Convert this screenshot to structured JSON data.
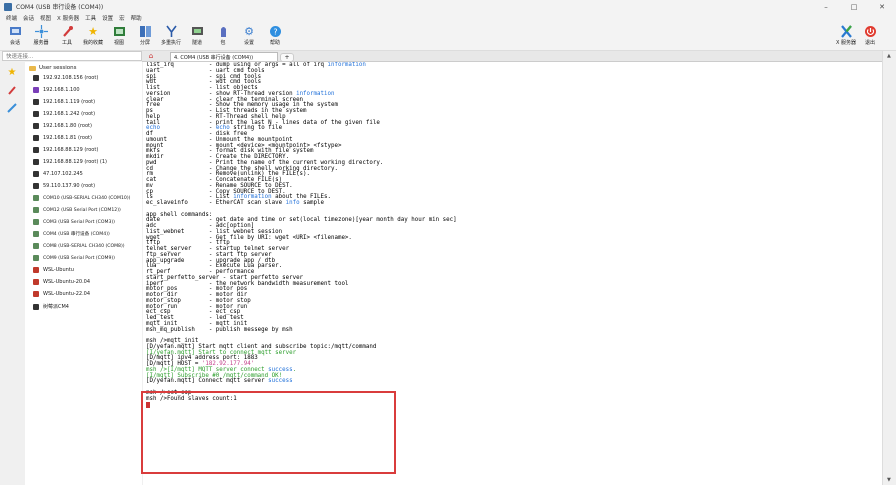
{
  "window": {
    "title": "COM4 (USB 串行设备 (COM4))",
    "controls": [
      "–",
      "□",
      "✕"
    ]
  },
  "menu": [
    "终端",
    "会话",
    "视图",
    "X 服务器",
    "工具",
    "设置",
    "宏",
    "帮助"
  ],
  "toolbar": [
    {
      "label": "会话",
      "icon": "session-icon"
    },
    {
      "label": "服务器",
      "icon": "servers-icon"
    },
    {
      "label": "工具",
      "icon": "tools-icon"
    },
    {
      "label": "我的收藏",
      "icon": "star-icon"
    },
    {
      "label": "视图",
      "icon": "view-icon"
    },
    {
      "label": "分屏",
      "icon": "split-icon"
    },
    {
      "label": "多重执行",
      "icon": "multiexec-icon"
    },
    {
      "label": "隧道",
      "icon": "tunnel-icon"
    },
    {
      "label": "包",
      "icon": "packages-icon"
    },
    {
      "label": "设置",
      "icon": "settings-icon"
    },
    {
      "label": "帮助",
      "icon": "help-icon"
    }
  ],
  "toolbar_right": [
    {
      "label": "X 服务器",
      "icon": "x-server-icon"
    },
    {
      "label": "退出",
      "icon": "exit-icon"
    }
  ],
  "quick_connect": {
    "placeholder": "快速连接..."
  },
  "sessions": {
    "root_label": "User sessions",
    "items": [
      {
        "label": "192.92.108.156 (root)",
        "icon": "ssh-icon"
      },
      {
        "label": "192.168.1.100",
        "icon": "ssh-icon"
      },
      {
        "label": "192.168.1.119 (root)",
        "icon": "ssh-icon"
      },
      {
        "label": "192.168.1.242 (root)",
        "icon": "ssh-icon"
      },
      {
        "label": "192.168.1.80 (root)",
        "icon": "ssh-icon"
      },
      {
        "label": "192.168.1.81 (root)",
        "icon": "ssh-icon"
      },
      {
        "label": "192.168.88.129 (root)",
        "icon": "ssh-icon"
      },
      {
        "label": "192.168.88.129 (root) (1)",
        "icon": "ssh-icon"
      },
      {
        "label": "47.107.102.245",
        "icon": "ssh-icon"
      },
      {
        "label": "59.110.137.90 (root)",
        "icon": "ssh-icon"
      },
      {
        "label": "COM10 (USB-SERIAL CH340 (COM10))",
        "icon": "serial-icon"
      },
      {
        "label": "COM12 (USB Serial Port (COM12))",
        "icon": "serial-icon"
      },
      {
        "label": "COM3 (USB Serial Port (COM3))",
        "icon": "serial-icon"
      },
      {
        "label": "COM4 (USB 串行设备 (COM4))",
        "icon": "serial-icon"
      },
      {
        "label": "COM8 (USB-SERIAL CH340 (COM8))",
        "icon": "serial-icon"
      },
      {
        "label": "COM9 (USB Serial Port (COM9))",
        "icon": "serial-icon"
      },
      {
        "label": "WSL-Ubuntu",
        "icon": "wsl-icon"
      },
      {
        "label": "WSL-Ubuntu-20.04",
        "icon": "wsl-icon"
      },
      {
        "label": "WSL-Ubuntu-22.04",
        "icon": "wsl-icon"
      },
      {
        "label": "树莓派CM4",
        "icon": "ssh-icon"
      }
    ]
  },
  "tab": {
    "label": "4. COM4 (USB 串行设备 (COM4))",
    "home_icon": "home-icon"
  },
  "terminal": {
    "lines": [
      {
        "text": "list_irq          - dump using or args = all of irq information",
        "color": "#000"
      },
      {
        "text": "uart              - uart cmd tools",
        "color": "#000"
      },
      {
        "text": "spi               - spi cmd tools",
        "color": "#000"
      },
      {
        "text": "wdt               - wdt cmd tools",
        "color": "#000"
      },
      {
        "text": "list              - list objects",
        "color": "#000"
      },
      {
        "text": "version           - show RT-Thread version information",
        "color": "#000"
      },
      {
        "text": "clear             - clear the terminal screen",
        "color": "#000"
      },
      {
        "text": "free              - Show the memory usage in the system",
        "color": "#000"
      },
      {
        "text": "ps                - List threads in the system",
        "color": "#000"
      },
      {
        "text": "help              - RT-Thread shell help",
        "color": "#000"
      },
      {
        "text": "tail              - print the last N - lines data of the given file",
        "color": "#000"
      },
      {
        "text": "echo              - echo string to file",
        "color": "#000"
      },
      {
        "text": "df                - disk free",
        "color": "#000"
      },
      {
        "text": "umount            - Unmount the mountpoint",
        "color": "#000"
      },
      {
        "text": "mount             - mount <device> <mountpoint> <fstype>",
        "color": "#000"
      },
      {
        "text": "mkfs              - format disk with file system",
        "color": "#000"
      },
      {
        "text": "mkdir             - Create the DIRECTORY.",
        "color": "#000"
      },
      {
        "text": "pwd               - Print the name of the current working directory.",
        "color": "#000"
      },
      {
        "text": "cd                - Change the shell working directory.",
        "color": "#000"
      },
      {
        "text": "rm                - Remove(unlink) the FILE(s).",
        "color": "#000"
      },
      {
        "text": "cat               - Concatenate FILE(s)",
        "color": "#000"
      },
      {
        "text": "mv                - Rename SOURCE to DEST.",
        "color": "#000"
      },
      {
        "text": "cp                - Copy SOURCE to DEST.",
        "color": "#000"
      },
      {
        "text": "ls                - List information about the FILEs.",
        "color": "#000"
      },
      {
        "text": "ec_slaveinfo      - EtherCAT scan slave info sample",
        "color": "#000"
      },
      {
        "text": "",
        "color": "#000"
      },
      {
        "text": "app shell commands:",
        "color": "#000"
      },
      {
        "text": "date              - get date and time or set(local timezone)[year month day hour min sec]",
        "color": "#000"
      },
      {
        "text": "adc               - adc[option]",
        "color": "#000"
      },
      {
        "text": "list_webnet       - list webnet session",
        "color": "#000"
      },
      {
        "text": "wget              - Get file by URI: wget <URI> <filename>.",
        "color": "#000"
      },
      {
        "text": "tftp              - tftp",
        "color": "#000"
      },
      {
        "text": "telnet_server     - startup telnet server",
        "color": "#000"
      },
      {
        "text": "ftp_server        - start ftp server",
        "color": "#000"
      },
      {
        "text": "app_upgrade       - upgrade app / dtb",
        "color": "#000"
      },
      {
        "text": "lua               - Execute Lua parser.",
        "color": "#000"
      },
      {
        "text": "rt_perf           - performance",
        "color": "#000"
      },
      {
        "text": "start_perfetto_server - start perfetto server",
        "color": "#000"
      },
      {
        "text": "iperf             - the network bandwidth measurement tool",
        "color": "#000"
      },
      {
        "text": "motor_pos         - motor pos",
        "color": "#000"
      },
      {
        "text": "motor_dir         - motor dir",
        "color": "#000"
      },
      {
        "text": "motor_stop        - motor stop",
        "color": "#000"
      },
      {
        "text": "motor_run         - motor run",
        "color": "#000"
      },
      {
        "text": "ect_csp           - ect_csp",
        "color": "#000"
      },
      {
        "text": "led_test          - led test",
        "color": "#000"
      },
      {
        "text": "mqtt_init         - mqtt init",
        "color": "#000"
      },
      {
        "text": "msh_mq_publish    - publish messege by msh",
        "color": "#000"
      },
      {
        "text": "",
        "color": "#000"
      },
      {
        "text": "msh />mqtt_init",
        "color": "#000"
      },
      {
        "text": "[D/yefan.mqtt] Start mqtt client and subscribe topic:/mqtt/command",
        "color": "#000"
      },
      {
        "text": "[I/yefan.mqtt] Start to connect mqtt server",
        "color": "#2a9d2a"
      },
      {
        "text": "[D/mqtt] ipv4 address port: 1883",
        "color": "#000"
      },
      {
        "text": "[D/mqtt] HOST = '182.92.177.94'",
        "color": "#000"
      },
      {
        "text": "msh />[I/mqtt] MQTT server connect success.",
        "color": "#2a9d2a"
      },
      {
        "text": "[I/mqtt] Subscribe #0 /mqtt/command OK!",
        "color": "#2a9d2a"
      },
      {
        "text": "[D/yefan.mqtt] Connect mqtt server success",
        "color": "#000"
      },
      {
        "text": "",
        "color": "#000"
      },
      {
        "text": "msh />ect_csp",
        "color": "#000"
      },
      {
        "text": "msh />Found slaves count:1",
        "color": "#000"
      },
      {
        "text": "",
        "color": "#000"
      }
    ],
    "keyword_color": "#1e6fd9",
    "highlight_color": "#d93c3c"
  }
}
